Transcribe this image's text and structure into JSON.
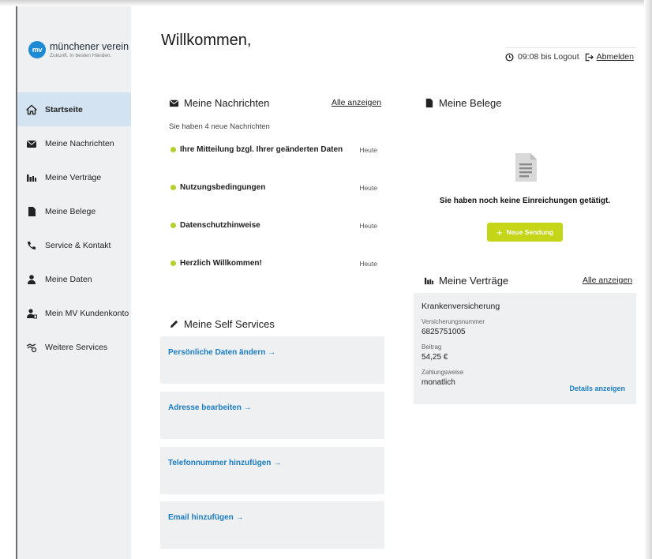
{
  "brand": {
    "logo_mark": "mv",
    "name": "münchener verein",
    "tagline": "Zukunft. In besten Händen."
  },
  "sidebar": {
    "items": [
      {
        "label": "Startseite",
        "icon": "home-icon",
        "active": true
      },
      {
        "label": "Meine Nachrichten",
        "icon": "envelope-icon",
        "active": false
      },
      {
        "label": "Meine Verträge",
        "icon": "contracts-icon",
        "active": false
      },
      {
        "label": "Meine Belege",
        "icon": "document-icon",
        "active": false
      },
      {
        "label": "Service & Kontakt",
        "icon": "phone-icon",
        "active": false
      },
      {
        "label": "Meine Daten",
        "icon": "person-icon",
        "active": false
      },
      {
        "label": "Mein MV Kundenkonto",
        "icon": "account-icon",
        "active": false
      },
      {
        "label": "Weitere Services",
        "icon": "services-icon",
        "active": false
      }
    ]
  },
  "header": {
    "welcome": "Willkommen,",
    "logout_time": "09:08 bis Logout",
    "logout_label": "Abmelden"
  },
  "messages": {
    "title": "Meine Nachrichten",
    "show_all": "Alle anzeigen",
    "count_text": "Sie haben 4 neue Nachrichten",
    "items": [
      {
        "title": "Ihre Mitteilung bzgl. Ihrer geänderten Daten",
        "date": "Heute"
      },
      {
        "title": "Nutzungsbedingungen",
        "date": "Heute"
      },
      {
        "title": "Datenschutzhinweise",
        "date": "Heute"
      },
      {
        "title": "Herzlich Willkommen!",
        "date": "Heute"
      }
    ]
  },
  "self_services": {
    "title": "Meine Self Services",
    "items": [
      {
        "label": "Persönliche Daten ändern →"
      },
      {
        "label": "Adresse bearbeiten →"
      },
      {
        "label": "Telefonnummer hinzufügen →"
      },
      {
        "label": "Email hinzufügen →"
      }
    ]
  },
  "belege": {
    "title": "Meine Belege",
    "empty_text": "Sie haben noch keine Einreichungen getätigt.",
    "new_button": "Neue Sendung",
    "new_button_icon": "plus-icon"
  },
  "contracts": {
    "title": "Meine Verträge",
    "show_all": "Alle anzeigen",
    "card": {
      "title": "Krankenversicherung",
      "number_label": "Versicherungsnummer",
      "number": "6825751005",
      "amount_label": "Beitrag",
      "amount": "54,25 €",
      "payment_label": "Zahlungsweise",
      "payment": "monatlich",
      "details_link": "Details anzeigen"
    }
  },
  "colors": {
    "accent_green": "#c4d617",
    "link_blue": "#1a7cc2",
    "sidebar_bg": "#eef0f2",
    "active_bg": "#d3e3f1",
    "brand_blue": "#1d8ad6"
  }
}
